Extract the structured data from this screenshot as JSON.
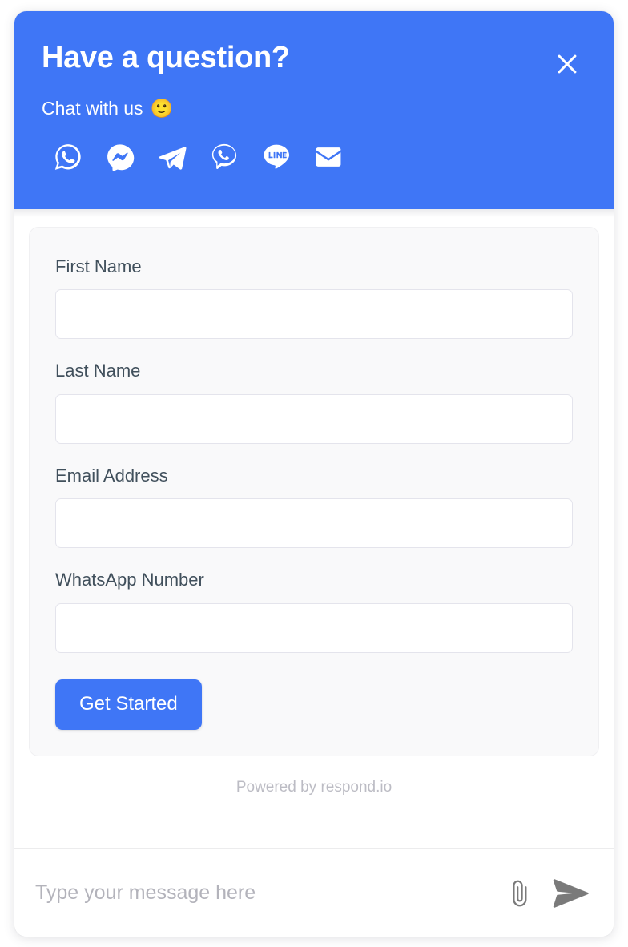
{
  "widget": {
    "header": {
      "title": "Have a question?",
      "subtitle": "Chat with us",
      "subtitle_emoji": "🙂",
      "close_label": "close-icon",
      "background_color": "#3f76f6",
      "text_color": "#ffffff",
      "channels": [
        {
          "name": "whatsapp",
          "label": "WhatsApp"
        },
        {
          "name": "messenger",
          "label": "Facebook Messenger"
        },
        {
          "name": "telegram",
          "label": "Telegram"
        },
        {
          "name": "viber",
          "label": "Viber"
        },
        {
          "name": "line",
          "label": "LINE"
        },
        {
          "name": "email",
          "label": "Email"
        }
      ]
    },
    "form": {
      "card_background": "#f9f9fa",
      "fields": [
        {
          "label": "First Name",
          "value": "",
          "placeholder": "",
          "type": "text"
        },
        {
          "label": "Last Name",
          "value": "",
          "placeholder": "",
          "type": "text"
        },
        {
          "label": "Email Address",
          "value": "",
          "placeholder": "",
          "type": "email"
        },
        {
          "label": "WhatsApp Number",
          "value": "",
          "placeholder": "",
          "type": "tel"
        }
      ],
      "submit_label": "Get Started",
      "submit_color": "#3f76f6"
    },
    "footer": {
      "powered_by": "Powered by respond.io"
    },
    "composer": {
      "placeholder": "Type your message here",
      "value": "",
      "attach_label": "paperclip-icon",
      "send_label": "send-icon",
      "icon_color": "#7a7a7a"
    }
  }
}
